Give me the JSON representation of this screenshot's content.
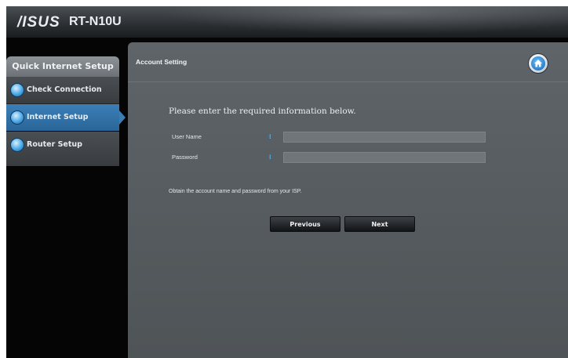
{
  "header": {
    "brand": "/ISUS",
    "model": "RT-N10U"
  },
  "sidebar": {
    "title": "Quick Internet Setup",
    "items": [
      {
        "label": "Check Connection",
        "state": "done"
      },
      {
        "label": "Internet Setup",
        "state": "active"
      },
      {
        "label": "Router Setup",
        "state": "pending"
      }
    ]
  },
  "panel": {
    "title": "Account Setting",
    "home_icon": "home-icon",
    "intro": "Please enter the required information below.",
    "user_label": "User Name",
    "password_label": "Password",
    "required_marker": "⁝",
    "user_value": "",
    "password_value": "",
    "hint": "Obtain the account name and password from your ISP.",
    "prev_label": "Previous",
    "next_label": "Next"
  },
  "colors": {
    "accent": "#3a7db5",
    "panel_bg": "#5a6064",
    "required": "#69c6ff"
  }
}
